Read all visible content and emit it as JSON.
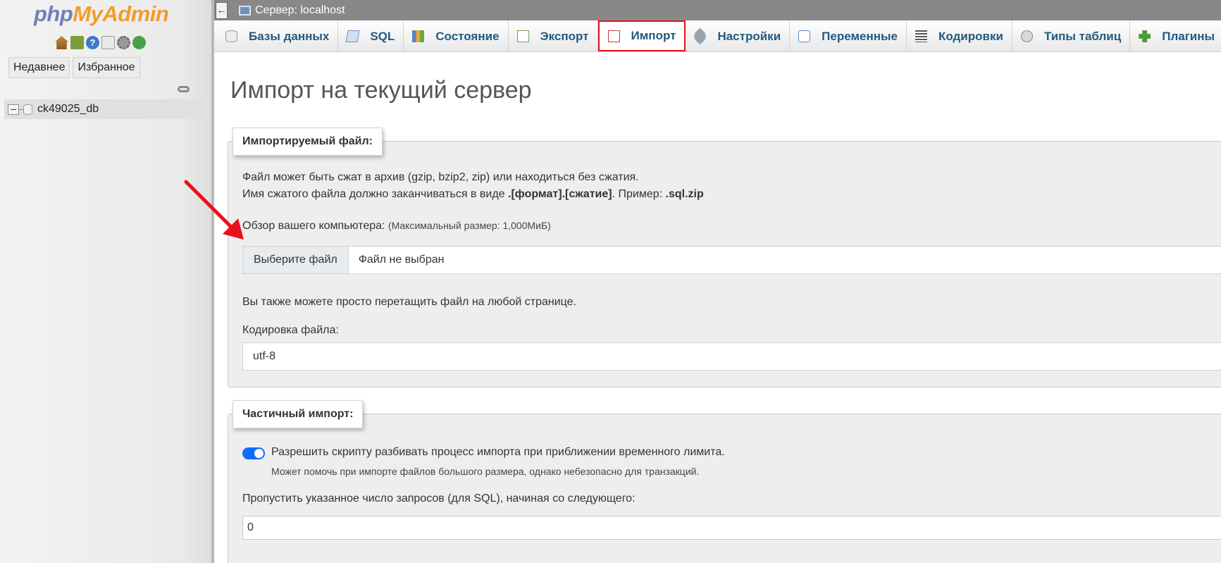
{
  "nav": {
    "logo_php": "php",
    "logo_myadmin": "MyAdmin",
    "icons": [
      "home-icon",
      "exit-icon",
      "help-icon",
      "docs-icon",
      "settings-icon",
      "reload-icon"
    ],
    "tabs": {
      "recent": "Недавнее",
      "favorites": "Избранное"
    },
    "databases": [
      {
        "name": "ck49025_db"
      }
    ]
  },
  "serverbar": {
    "collapse_glyph": "←",
    "label": "Сервер: localhost"
  },
  "topmenu": {
    "tabs": [
      {
        "label": "Базы данных",
        "icon": "database-icon"
      },
      {
        "label": "SQL",
        "icon": "sql-icon"
      },
      {
        "label": "Состояние",
        "icon": "status-icon"
      },
      {
        "label": "Экспорт",
        "icon": "export-icon"
      },
      {
        "label": "Импорт",
        "icon": "import-icon",
        "active": true
      },
      {
        "label": "Настройки",
        "icon": "settings-wrench-icon"
      },
      {
        "label": "Переменные",
        "icon": "variables-icon"
      },
      {
        "label": "Кодировки",
        "icon": "charset-icon"
      },
      {
        "label": "Типы таблиц",
        "icon": "engines-icon"
      },
      {
        "label": "Плагины",
        "icon": "plugins-icon"
      }
    ],
    "active_highlight_color": "#e6101c"
  },
  "content": {
    "title": "Импорт на текущий сервер",
    "file_section": {
      "legend": "Импортируемый файл:",
      "compression_note": "Файл может быть сжат в архив (gzip, bzip2, zip) или находиться без сжатия.",
      "naming_prefix": "Имя сжатого файла должно заканчиваться в виде ",
      "naming_format": ".[формат].[сжатие]",
      "naming_example_label": ". Пример: ",
      "naming_example": ".sql.zip",
      "browse_label": "Обзор вашего компьютера:",
      "max_size": "(Максимальный размер: 1,000МиБ)",
      "choose_file_button": "Выберите файл",
      "file_status": "Файл не выбран",
      "drag_note": "Вы также можете просто перетащить файл на любой странице.",
      "charset_label": "Кодировка файла:",
      "charset_value": "utf-8"
    },
    "partial_section": {
      "legend": "Частичный импорт:",
      "allow_interrupt_label": "Разрешить скрипту разбивать процесс импорта при приближении временного лимита.",
      "allow_interrupt_enabled": true,
      "allow_interrupt_hint": "Может помочь при импорте файлов большого размера, однако небезопасно для транзакций.",
      "skip_label": "Пропустить указанное число запросов (для SQL), начиная со следующего:",
      "skip_value": "0"
    }
  },
  "annotation": {
    "arrow_color": "#e8101a"
  }
}
